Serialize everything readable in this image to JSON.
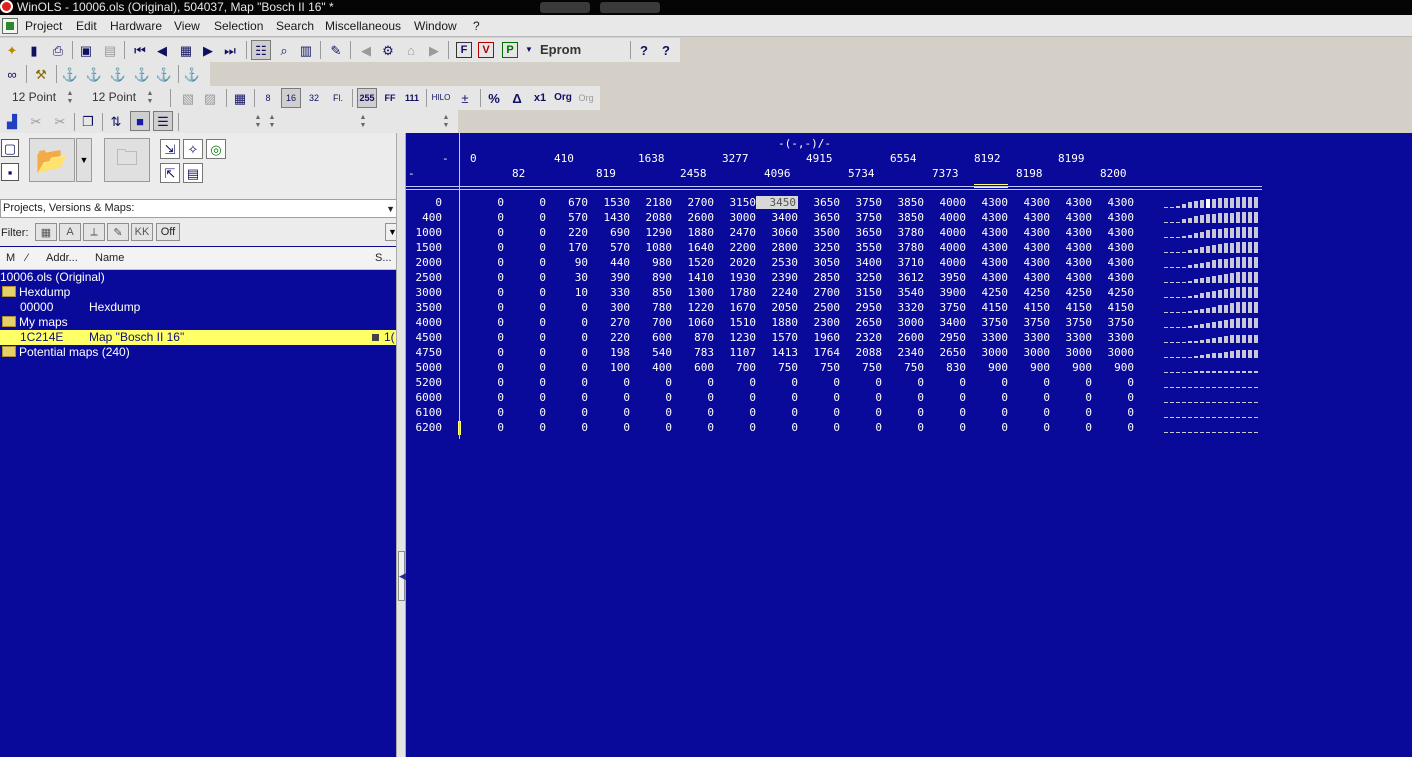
{
  "window": {
    "title": "WinOLS - 10006.ols (Original), 504037, Map \"Bosch II 16\" *"
  },
  "menu": [
    "Project",
    "Edit",
    "Hardware",
    "View",
    "Selection",
    "Search",
    "Miscellaneous",
    "Window",
    "?"
  ],
  "toolbar": {
    "eprom_label": "Eprom",
    "font1": "12 Point",
    "font2": "12 Point",
    "width_buttons": [
      "8",
      "16",
      "32",
      "Fl."
    ],
    "radix_buttons": [
      "255",
      "FF",
      "111"
    ],
    "hilo_label": "HILO",
    "orig_label": "Org",
    "times_label": "x1"
  },
  "left": {
    "combo_label": "Projects, Versions & Maps:",
    "filter_label": "Filter:",
    "filter_off": "Off",
    "columns": {
      "m": "M",
      "flag": "⁄",
      "addr": "Addr...",
      "name": "Name",
      "s": "S..."
    },
    "tree": {
      "root": "10006.ols (Original)",
      "hexdump_folder": "Hexdump",
      "hexdump_addr": "00000",
      "hexdump_name": "Hexdump",
      "mymaps_folder": "My maps",
      "map_addr": "1C214E",
      "map_name": "Map \"Bosch II 16\"",
      "map_tail": "1(",
      "potential_folder": "Potential maps (240)"
    }
  },
  "map": {
    "axis_title": "-(-,-)/-",
    "corner": "-",
    "corner_left": "-",
    "x_axis_top": [
      "0",
      "410",
      "1638",
      "3277",
      "4915",
      "6554",
      "8192",
      "8199"
    ],
    "x_axis_bottom": [
      "82",
      "819",
      "2458",
      "4096",
      "5734",
      "7373",
      "8198",
      "8200"
    ],
    "y_axis": [
      "0",
      "400",
      "1000",
      "1500",
      "2000",
      "2500",
      "3000",
      "3500",
      "4000",
      "4500",
      "4750",
      "5000",
      "5200",
      "6000",
      "6100",
      "6200"
    ],
    "highlight": {
      "row": 0,
      "col": 7
    },
    "rows": [
      [
        "0",
        "0",
        "670",
        "1530",
        "2180",
        "2700",
        "3150",
        "3450",
        "3650",
        "3750",
        "3850",
        "4000",
        "4300",
        "4300",
        "4300",
        "4300"
      ],
      [
        "0",
        "0",
        "570",
        "1430",
        "2080",
        "2600",
        "3000",
        "3400",
        "3650",
        "3750",
        "3850",
        "4000",
        "4300",
        "4300",
        "4300",
        "4300"
      ],
      [
        "0",
        "0",
        "220",
        "690",
        "1290",
        "1880",
        "2470",
        "3060",
        "3500",
        "3650",
        "3780",
        "4000",
        "4300",
        "4300",
        "4300",
        "4300"
      ],
      [
        "0",
        "0",
        "170",
        "570",
        "1080",
        "1640",
        "2200",
        "2800",
        "3250",
        "3550",
        "3780",
        "4000",
        "4300",
        "4300",
        "4300",
        "4300"
      ],
      [
        "0",
        "0",
        "90",
        "440",
        "980",
        "1520",
        "2020",
        "2530",
        "3050",
        "3400",
        "3710",
        "4000",
        "4300",
        "4300",
        "4300",
        "4300"
      ],
      [
        "0",
        "0",
        "30",
        "390",
        "890",
        "1410",
        "1930",
        "2390",
        "2850",
        "3250",
        "3612",
        "3950",
        "4300",
        "4300",
        "4300",
        "4300"
      ],
      [
        "0",
        "0",
        "10",
        "330",
        "850",
        "1300",
        "1780",
        "2240",
        "2700",
        "3150",
        "3540",
        "3900",
        "4250",
        "4250",
        "4250",
        "4250"
      ],
      [
        "0",
        "0",
        "0",
        "300",
        "780",
        "1220",
        "1670",
        "2050",
        "2500",
        "2950",
        "3320",
        "3750",
        "4150",
        "4150",
        "4150",
        "4150"
      ],
      [
        "0",
        "0",
        "0",
        "270",
        "700",
        "1060",
        "1510",
        "1880",
        "2300",
        "2650",
        "3000",
        "3400",
        "3750",
        "3750",
        "3750",
        "3750"
      ],
      [
        "0",
        "0",
        "0",
        "220",
        "600",
        "870",
        "1230",
        "1570",
        "1960",
        "2320",
        "2600",
        "2950",
        "3300",
        "3300",
        "3300",
        "3300"
      ],
      [
        "0",
        "0",
        "0",
        "198",
        "540",
        "783",
        "1107",
        "1413",
        "1764",
        "2088",
        "2340",
        "2650",
        "3000",
        "3000",
        "3000",
        "3000"
      ],
      [
        "0",
        "0",
        "0",
        "100",
        "400",
        "600",
        "700",
        "750",
        "750",
        "750",
        "750",
        "830",
        "900",
        "900",
        "900",
        "900"
      ],
      [
        "0",
        "0",
        "0",
        "0",
        "0",
        "0",
        "0",
        "0",
        "0",
        "0",
        "0",
        "0",
        "0",
        "0",
        "0",
        "0"
      ],
      [
        "0",
        "0",
        "0",
        "0",
        "0",
        "0",
        "0",
        "0",
        "0",
        "0",
        "0",
        "0",
        "0",
        "0",
        "0",
        "0"
      ],
      [
        "0",
        "0",
        "0",
        "0",
        "0",
        "0",
        "0",
        "0",
        "0",
        "0",
        "0",
        "0",
        "0",
        "0",
        "0",
        "0"
      ],
      [
        "0",
        "0",
        "0",
        "0",
        "0",
        "0",
        "0",
        "0",
        "0",
        "0",
        "0",
        "0",
        "0",
        "0",
        "0",
        "0"
      ]
    ]
  }
}
